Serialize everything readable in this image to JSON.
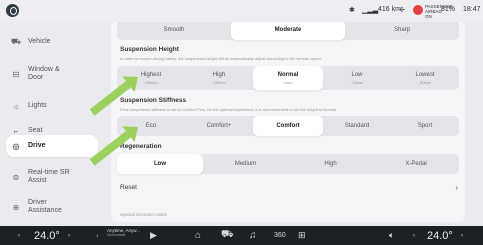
{
  "status": {
    "passenger_airbag": "PASSENGER AIRBAG ON",
    "range": "416 km",
    "battery": "81%",
    "time": "18:47"
  },
  "sidebar": {
    "items": [
      {
        "label": "Vehicle",
        "icon": "car-icon",
        "active": false
      },
      {
        "label": "Window & Door",
        "icon": "door-icon",
        "active": false
      },
      {
        "label": "Lights",
        "icon": "lights-icon",
        "active": false
      },
      {
        "label": "Seat",
        "icon": "seat-icon",
        "active": false
      },
      {
        "label": "Drive",
        "icon": "steering-wheel-icon",
        "active": true
      },
      {
        "label": "Real-time SR Assist",
        "icon": "sr-assist-icon",
        "active": false
      },
      {
        "label": "Driver Assistance",
        "icon": "driver-assist-icon",
        "active": false
      }
    ]
  },
  "top_selector": {
    "options": [
      "Smooth",
      "Moderate",
      "Sharp"
    ],
    "selected": "Moderate"
  },
  "suspension_height": {
    "title": "Suspension Height",
    "desc": "In order to ensure driving safety, the suspension height will be automatically adjust according to the vehicle speed",
    "options": [
      {
        "label": "Highest",
        "sub": "+50mm"
      },
      {
        "label": "High",
        "sub": "+30mm"
      },
      {
        "label": "Normal",
        "sub": "0mm"
      },
      {
        "label": "Low",
        "sub": "-15mm"
      },
      {
        "label": "Lowest",
        "sub": "-50mm"
      }
    ],
    "selected": "Normal"
  },
  "suspension_stiffness": {
    "title": "Suspension Stiffness",
    "desc": "If the suspension stiffness is set to Comfort Plus, for the optimal experience, it is recommended to set the height to Normal",
    "options": [
      "Eco",
      "Comfort+",
      "Comfort",
      "Standard",
      "Sport"
    ],
    "selected": "Comfort"
  },
  "regeneration": {
    "title": "Regeneration",
    "options": [
      "Low",
      "Medium",
      "High",
      "X-Pedal"
    ],
    "selected": "Low"
  },
  "reset_label": "Reset",
  "special_label": "Special Scenario Assist",
  "bottom": {
    "left_temp": "24.0°",
    "right_temp": "24.0°",
    "media_title": "Anytime, Anyw...",
    "media_sub": "Motorshade"
  },
  "colors": {
    "arrow": "#9cd15e",
    "background": "#e9ebef",
    "panel": "#f4f5f7",
    "bottom_bar": "#1d2024"
  }
}
